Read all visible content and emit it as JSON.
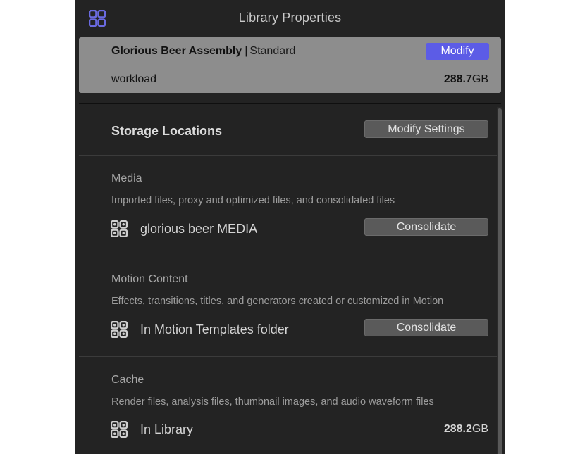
{
  "header": {
    "title": "Library Properties",
    "icon": "library-icon"
  },
  "library": {
    "name": "Glorious Beer Assembly",
    "separator": "|",
    "type": "Standard",
    "modify_label": "Modify",
    "workload_label": "workload",
    "size_value": "288.7",
    "size_unit": "GB"
  },
  "storage": {
    "title": "Storage Locations",
    "modify_settings_label": "Modify Settings"
  },
  "sections": [
    {
      "heading": "Media",
      "description": "Imported files, proxy and optimized files, and consolidated files",
      "location_icon": "library-icon",
      "location_label": "glorious beer MEDIA",
      "action_label": "Consolidate"
    },
    {
      "heading": "Motion Content",
      "description": "Effects, transitions, titles, and generators created or customized in Motion",
      "location_icon": "library-icon",
      "location_label": "In Motion Templates folder",
      "action_label": "Consolidate"
    },
    {
      "heading": "Cache",
      "description": "Render files, analysis files, thumbnail images, and audio waveform files",
      "location_icon": "library-icon",
      "location_label": "In Library",
      "size_value": "288.2",
      "size_unit": "GB"
    }
  ],
  "colors": {
    "accent": "#5c5ce6",
    "panel_bg": "#232323",
    "card_bg": "#8d8d8d"
  }
}
